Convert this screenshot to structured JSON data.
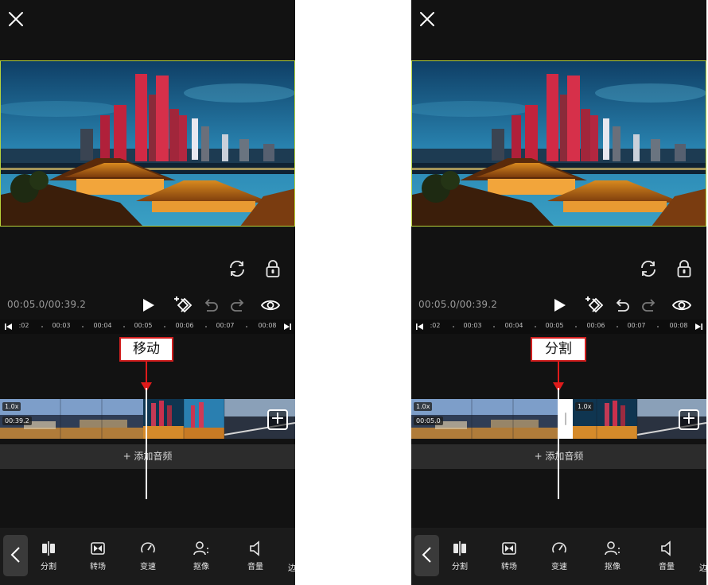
{
  "screens": [
    {
      "timecode": "00:05.0/00:39.2",
      "ruler_ticks": [
        ":02",
        "00:03",
        "00:04",
        "00:05",
        "00:06",
        "00:07",
        "00:08"
      ],
      "annotation": "移动",
      "clip_speed": "1.0x",
      "clip_duration": "00:39.2",
      "add_audio_label": "+ 添加音频",
      "add_clip_label": "+",
      "tools": [
        "分割",
        "转场",
        "变速",
        "抠像",
        "音量"
      ],
      "tool_overflow": "边"
    },
    {
      "timecode": "00:05.0/00:39.2",
      "ruler_ticks": [
        ":02",
        "00:03",
        "00:04",
        "00:05",
        "00:06",
        "00:07",
        "00:08"
      ],
      "annotation": "分割",
      "clip_speed": "1.0x",
      "clip_duration": "00:05.0",
      "second_clip_speed": "1.0x",
      "add_audio_label": "+ 添加音频",
      "add_clip_label": "+",
      "tools": [
        "分割",
        "转场",
        "变速",
        "抠像",
        "音量"
      ],
      "tool_overflow": "边"
    }
  ],
  "icons": {
    "close": "close-icon",
    "rotate": "rotate-icon",
    "lock": "lock-icon",
    "play": "play-icon",
    "keyframe": "keyframe-add-icon",
    "undo": "undo-icon",
    "redo": "redo-icon",
    "preview": "eye-icon",
    "back": "chevron-left-icon",
    "tools": [
      "split-icon",
      "transition-icon",
      "speed-icon",
      "cutout-icon",
      "volume-icon"
    ]
  },
  "colors": {
    "background": "#121212",
    "preview_border": "#b7d23a",
    "annotation_border": "#d21f1f",
    "annotation_arrow": "#e01b1b",
    "audio_row": "#2c2c2c",
    "toolbar": "#1b1b1b"
  }
}
